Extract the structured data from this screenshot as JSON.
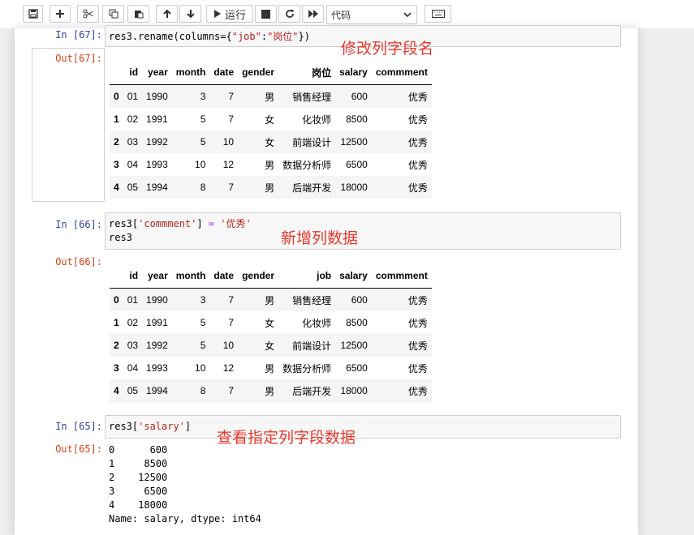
{
  "toolbar": {
    "run_label": "运行",
    "cell_type": "代码"
  },
  "cells": [
    {
      "in_prompt": "In  [67]:",
      "code_prefix": "res3.rename(columns={",
      "code_str1": "\"job\"",
      "code_colon": ":",
      "code_str2": "\"岗位\"",
      "code_suffix": "})",
      "annotation": "修改列字段名",
      "out_prompt": "Out[67]:",
      "columns": [
        "",
        "id",
        "year",
        "month",
        "date",
        "gender",
        "岗位",
        "salary",
        "commment"
      ],
      "rows": [
        [
          "0",
          "01",
          "1990",
          "3",
          "7",
          "男",
          "销售经理",
          "600",
          "优秀"
        ],
        [
          "1",
          "02",
          "1991",
          "5",
          "7",
          "女",
          "化妆师",
          "8500",
          "优秀"
        ],
        [
          "2",
          "03",
          "1992",
          "5",
          "10",
          "女",
          "前端设计",
          "12500",
          "优秀"
        ],
        [
          "3",
          "04",
          "1993",
          "10",
          "12",
          "男",
          "数据分析师",
          "6500",
          "优秀"
        ],
        [
          "4",
          "05",
          "1994",
          "8",
          "7",
          "男",
          "后端开发",
          "18000",
          "优秀"
        ]
      ]
    },
    {
      "in_prompt": "In  [66]:",
      "code_line1_prefix": "res3[",
      "code_line1_str1": "'commment'",
      "code_line1_mid": "] ",
      "code_line1_op": "=",
      "code_line1_space": " ",
      "code_line1_str2": "'优秀'",
      "code_line2": "res3",
      "annotation": "新增列数据",
      "out_prompt": "Out[66]:",
      "columns": [
        "",
        "id",
        "year",
        "month",
        "date",
        "gender",
        "job",
        "salary",
        "commment"
      ],
      "rows": [
        [
          "0",
          "01",
          "1990",
          "3",
          "7",
          "男",
          "销售经理",
          "600",
          "优秀"
        ],
        [
          "1",
          "02",
          "1991",
          "5",
          "7",
          "女",
          "化妆师",
          "8500",
          "优秀"
        ],
        [
          "2",
          "03",
          "1992",
          "5",
          "10",
          "女",
          "前端设计",
          "12500",
          "优秀"
        ],
        [
          "3",
          "04",
          "1993",
          "10",
          "12",
          "男",
          "数据分析师",
          "6500",
          "优秀"
        ],
        [
          "4",
          "05",
          "1994",
          "8",
          "7",
          "男",
          "后端开发",
          "18000",
          "优秀"
        ]
      ]
    },
    {
      "in_prompt": "In  [65]:",
      "code_prefix": "res3[",
      "code_str": "'salary'",
      "code_suffix": "]",
      "annotation": "查看指定列字段数据",
      "out_prompt": "Out[65]:",
      "series_lines": [
        "0      600",
        "1     8500",
        "2    12500",
        "3     6500",
        "4    18000",
        "Name: salary, dtype: int64"
      ]
    }
  ],
  "icons": [
    "save-icon",
    "plus-icon",
    "scissors-icon",
    "copy-icon",
    "paste-icon",
    "arrow-up-icon",
    "arrow-down-icon",
    "play-icon",
    "stop-icon",
    "refresh-icon",
    "fast-forward-icon",
    "chevron-down-icon",
    "keyboard-icon"
  ],
  "colors": {
    "prompt_in": "#303f9f",
    "prompt_out": "#d84315",
    "annotation": "#e8382c",
    "string": "#ba2121"
  }
}
